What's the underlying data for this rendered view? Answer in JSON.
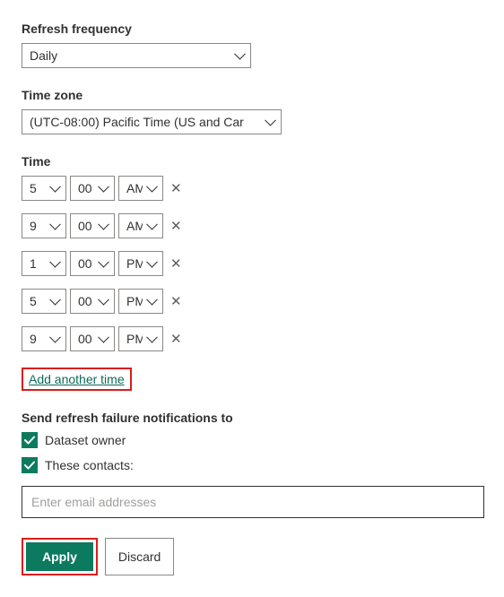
{
  "refresh_frequency": {
    "label": "Refresh frequency",
    "value": "Daily"
  },
  "timezone": {
    "label": "Time zone",
    "value": "(UTC-08:00) Pacific Time (US and Car"
  },
  "time": {
    "label": "Time",
    "rows": [
      {
        "hour": "5",
        "minute": "00",
        "ampm": "AM"
      },
      {
        "hour": "9",
        "minute": "00",
        "ampm": "AM"
      },
      {
        "hour": "1",
        "minute": "00",
        "ampm": "PM"
      },
      {
        "hour": "5",
        "minute": "00",
        "ampm": "PM"
      },
      {
        "hour": "9",
        "minute": "00",
        "ampm": "PM"
      }
    ],
    "add_label": "Add another time"
  },
  "notifications": {
    "label": "Send refresh failure notifications to",
    "owner_label": "Dataset owner",
    "contacts_label": "These contacts:",
    "owner_checked": true,
    "contacts_checked": true,
    "email_placeholder": "Enter email addresses"
  },
  "buttons": {
    "apply": "Apply",
    "discard": "Discard"
  }
}
